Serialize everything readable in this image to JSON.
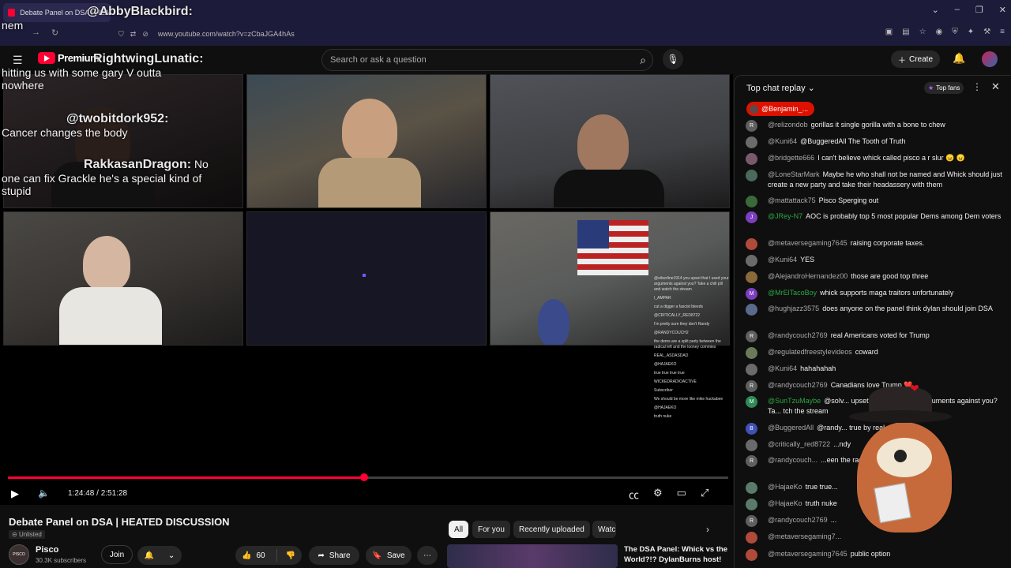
{
  "browser": {
    "tab_title": "Debate Panel on DSA | HEATE",
    "url": "www.youtube.com/watch?v=zCbaJGA4hAs",
    "min": "–",
    "max": "❐",
    "close": "✕",
    "down": "⌄"
  },
  "header": {
    "logo_text": "Premium",
    "search_placeholder": "Search or ask a question",
    "create_label": "Create"
  },
  "overlay_chat": [
    {
      "name": "@AbbyBlackbird:",
      "text": "nem"
    },
    {
      "name": "RightwingLunatic:",
      "text": "hitting us with some gary V outta nowhere"
    },
    {
      "name": "@twobitdork952:",
      "text": "Cancer changes the body"
    },
    {
      "name": "RakkasanDragon:",
      "text": "No one can fix Grackle he's a special kind of stupid"
    }
  ],
  "mini_chat": [
    "@silverline1914 you upset that I used your arguments against you? Take a chill pill and watch the stream",
    "I_AMPAR",
    "cut a digger a fascist bleeds",
    "@CRITICALLY_RED8722",
    "I'm pretty sure they don't Randy",
    "@RANDYCOUCH2",
    "the dems are a split party between the radical left and the looney commies",
    "REAL_ASDASDAD",
    "@HAJAEKO",
    "true true true true",
    "WICKEDRADIOACTIVE",
    "Subscriber",
    "We should be more like mike huckabee",
    "@HAJAEKO",
    "truth nuke"
  ],
  "player": {
    "current_time": "1:24:48",
    "duration": "2:51:28",
    "progress": 0.495
  },
  "video": {
    "title": "Debate Panel on DSA | HEATED DISCUSSION",
    "visibility": "Unlisted",
    "channel_name": "Pisco",
    "channel_avatar_text": "PISCO",
    "subscribers": "30.3K subscribers",
    "join_label": "Join",
    "likes": "60",
    "share_label": "Share",
    "save_label": "Save"
  },
  "chips": [
    "All",
    "For you",
    "Recently uploaded",
    "Watc"
  ],
  "recommendation": {
    "title": "The DSA Panel: Whick vs the World?!? DylanBurns host!"
  },
  "chat": {
    "mode": "Top chat replay",
    "top_fans": "Top fans",
    "pinned_user": "@Benjamin_...",
    "messages": [
      {
        "author": "@relizondob",
        "text": "gorillas it single gorilla with a bone to chew",
        "initial": "R",
        "color": "#5f5f5f",
        "member": false
      },
      {
        "author": "@Kuni64",
        "text": "@BuggeredAll The Tooth of Truth",
        "initial": "",
        "color": "#6b6b6b",
        "member": false
      },
      {
        "author": "@bridgette666",
        "text": "I can't believe whick called pisco a r slur 😠 😠",
        "initial": "",
        "color": "#7a5a6a",
        "member": false
      },
      {
        "author": "@LoneStarMark",
        "text": "Maybe he who shall not be named and Whick should just create a new party and take their headassery with them",
        "initial": "",
        "color": "#4a6a5a",
        "member": false
      },
      {
        "author": "@mattattack75",
        "text": "Pisco Sperging out",
        "initial": "",
        "color": "#3a6a3a",
        "member": false
      },
      {
        "author": "@JRey-N7",
        "text": "AOC is probably top 5 most popular Dems among Dem voters",
        "initial": "J",
        "color": "#7b3fbf",
        "member": true
      },
      {
        "author": "@metaversegaming7645",
        "text": "raising corporate taxes.",
        "initial": "",
        "color": "#b04a3a",
        "member": false
      },
      {
        "author": "@Kuni64",
        "text": "YES",
        "initial": "",
        "color": "#6b6b6b",
        "member": false
      },
      {
        "author": "@AlejandroHernandez00",
        "text": "those are good top three",
        "initial": "",
        "color": "#8a6a3a",
        "member": false
      },
      {
        "author": "@MrElTacoBoy",
        "text": "whick supports maga traitors unfortunately",
        "initial": "M",
        "color": "#7b3fbf",
        "member": true
      },
      {
        "author": "@hughjazz3575",
        "text": "does anyone on the panel think dylan should join DSA",
        "initial": "",
        "color": "#5a6a8a",
        "member": false
      },
      {
        "author": "@randycouch2769",
        "text": "real Americans voted for Trump",
        "initial": "R",
        "color": "#5f5f5f",
        "member": false
      },
      {
        "author": "@regulatedfreestylevideos",
        "text": "coward",
        "initial": "",
        "color": "#6a7a5a",
        "member": false
      },
      {
        "author": "@Kuni64",
        "text": "hahahahah",
        "initial": "",
        "color": "#6b6b6b",
        "member": false
      },
      {
        "author": "@randycouch2769",
        "text": "Canadians love Trump ❤️",
        "initial": "R",
        "color": "#5f5f5f",
        "member": false
      },
      {
        "author": "@SunTzuMaybe",
        "text": "@solv... upset that I used your arguments against you? Ta... tch the stream",
        "initial": "M",
        "color": "#2e8b57",
        "member": true
      },
      {
        "author": "@BuggeredAll",
        "text": "@randy... true by real patriots",
        "initial": "B",
        "color": "#3f51b5",
        "member": false
      },
      {
        "author": "@critically_red8722",
        "text": "...ndy",
        "initial": "",
        "color": "#6a6a6a",
        "member": false
      },
      {
        "author": "@randycouch...",
        "text": "...een the radical left and the looney ...",
        "initial": "R",
        "color": "#5f5f5f",
        "member": false
      },
      {
        "author": "@HajaeKo",
        "text": "true true...",
        "initial": "",
        "color": "#5a7a6a",
        "member": false
      },
      {
        "author": "@HajaeKo",
        "text": "truth nuke",
        "initial": "",
        "color": "#5a7a6a",
        "member": false
      },
      {
        "author": "@randycouch2769",
        "text": "...",
        "initial": "R",
        "color": "#5f5f5f",
        "member": false
      },
      {
        "author": "@metaversegaming7...",
        "text": "",
        "initial": "",
        "color": "#b04a3a",
        "member": false
      },
      {
        "author": "@metaversegaming7645",
        "text": "public option",
        "initial": "",
        "color": "#b04a3a",
        "member": false
      }
    ]
  }
}
